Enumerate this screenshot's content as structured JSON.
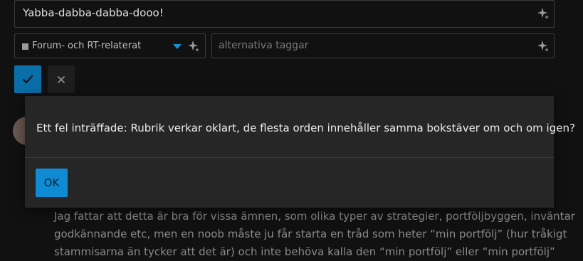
{
  "composer": {
    "title_value": "Yabba-dabba-dabba-dooo!",
    "category_label": "Forum- och RT-relaterat",
    "tags_placeholder": "alternativa taggar",
    "colors": {
      "accent": "#0a6fa8",
      "caret": "#1a8fd0",
      "category_swatch": "#9a9a9a"
    }
  },
  "icons": {
    "sparkle": "sparkle-icon",
    "confirm": "check-icon",
    "cancel": "close-icon",
    "dropdown": "caret-down-icon"
  },
  "background_post": {
    "lines": [
      "Jag fattar att detta är bra för vissa ämnen, som olika typer av strategier, portföljbyggen, inväntar",
      "godkännande etc, men en noob måste ju får starta en tråd som heter “min portfölj” (hur tråkigt",
      "stammisarna än tycker att det är) och inte behöva kalla den “min portfölj” eller “min portfölj”"
    ]
  },
  "dialog": {
    "message": "Ett fel inträffade: Rubrik verkar oklart, de flesta orden innehåller samma bokstäver om och om igen?",
    "ok_label": "OK",
    "colors": {
      "ok_button": "#0f8bd3",
      "panel": "#262626"
    }
  }
}
